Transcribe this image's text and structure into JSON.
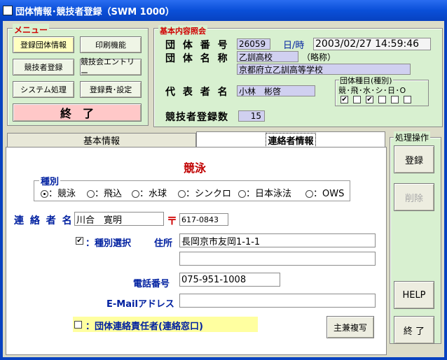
{
  "window": {
    "title": "団体情報･競技者登録（SWM 1000）"
  },
  "menu": {
    "title": "メニュー",
    "buttons": {
      "team_register": "登録団体情報",
      "print": "印刷機能",
      "athlete_register": "競技者登録",
      "meet_entry": "競技会エントリー",
      "system": "システム処理",
      "fee_settings": "登録費･設定",
      "exit": "終　了"
    }
  },
  "basic": {
    "title": "基本内容照会",
    "team_number_label": "団 体 番 号",
    "team_number": "26059",
    "datetime_label": "日/時",
    "datetime": "2003/02/27 14:59:46",
    "team_name_label": "団 体 名 称",
    "team_name_short": "乙訓高校",
    "abbrev_label": "（略称）",
    "team_name_full": "京都府立乙訓高等学校",
    "rep_label": "代 表 者 名",
    "rep_name": "小林　彬啓",
    "category_title": "団体種目(種別)",
    "category_headers": "競･飛･水･シ･日･O",
    "category_checks": [
      true,
      false,
      true,
      false,
      false,
      false
    ],
    "athlete_count_label": "競技者登録数",
    "athlete_count": "15"
  },
  "tabs": {
    "basic_info": "基本情報",
    "contact_info": "連絡者情報"
  },
  "contact": {
    "heading": "競泳",
    "kind_title": "種別",
    "kinds": [
      {
        "label": "：競泳",
        "selected": true
      },
      {
        "label": "：飛込",
        "selected": false
      },
      {
        "label": "：水球",
        "selected": false
      },
      {
        "label": "：シンクロ",
        "selected": false
      },
      {
        "label": "：日本泳法",
        "selected": false
      },
      {
        "label": "：OWS",
        "selected": false
      }
    ],
    "name_label": "連 絡 者 名",
    "name_value": "川合　寛明",
    "zip_mark": "〒",
    "zip_value": "617-0843",
    "kind_select_label": "：種別選択",
    "kind_select_checked": true,
    "address_label": "住所",
    "address_1": "長岡京市友岡1-1-1",
    "address_2": "",
    "phone_label": "電話番号",
    "phone_value": "075-951-1008",
    "email_label": "E-Mailアドレス",
    "email_value": "",
    "responsible_label": "：団体連絡責任者(連絡窓口)",
    "responsible_checked": false,
    "copy_button": "主兼複写"
  },
  "ops": {
    "title": "処理操作",
    "register": "登録",
    "delete": "削除",
    "help": "HELP",
    "exit": "終 了"
  }
}
